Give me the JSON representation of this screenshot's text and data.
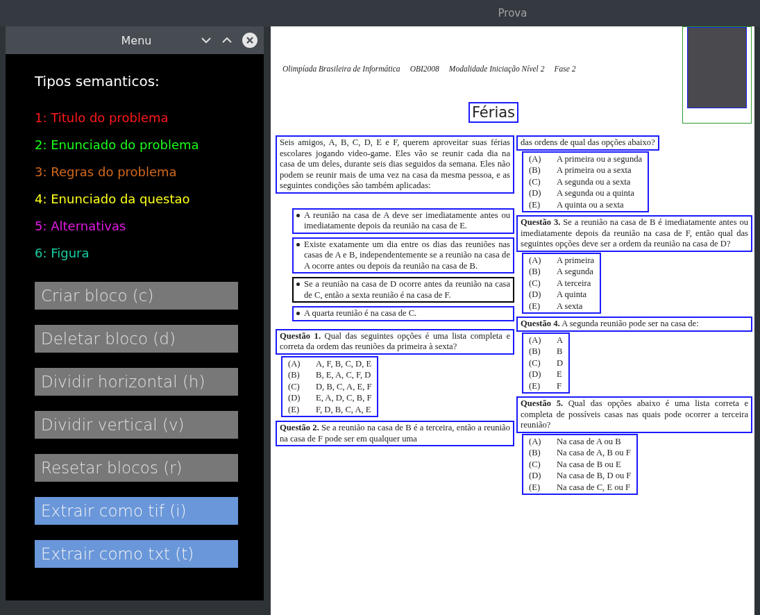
{
  "window": {
    "title": "Prova"
  },
  "menu": {
    "title": "Menu",
    "heading": "Tipos semanticos:",
    "legend": [
      {
        "text": "1: Titulo do problema",
        "color": "#ff1a1a"
      },
      {
        "text": "2: Enunciado do problema",
        "color": "#1aff1a"
      },
      {
        "text": "3: Regras do problema",
        "color": "#d2691e"
      },
      {
        "text": "4: Enunciado da questao",
        "color": "#ffff1a"
      },
      {
        "text": "5: Alternativas",
        "color": "#e01ae0"
      },
      {
        "text": "6: Figura",
        "color": "#1acca0"
      }
    ],
    "buttons": [
      {
        "label": "Criar bloco (c)",
        "color": "#787878"
      },
      {
        "label": "Deletar bloco (d)",
        "color": "#787878"
      },
      {
        "label": "Dividir horizontal (h)",
        "color": "#787878"
      },
      {
        "label": "Dividir vertical (v)",
        "color": "#787878"
      },
      {
        "label": "Resetar blocos (r)",
        "color": "#787878"
      },
      {
        "label": "Extrair como tif (i)",
        "color": "#6a97da"
      },
      {
        "label": "Extrair como txt (t)",
        "color": "#6a97da"
      }
    ]
  },
  "document": {
    "header": [
      "Olimpíada Brasileira de Informática",
      "OBI2008",
      "Modalidade Iniciação Nível 2",
      "Fase 2"
    ],
    "title": {
      "text": "Férias",
      "color": "#1a1aff"
    },
    "left_column": [
      {
        "kind": "paragraph",
        "color": "#1a1aff",
        "text": "Seis amigos, A, B, C, D, E e F, querem aproveitar suas férias escolares jogando video-game. Eles vão se reunir cada dia na casa de um deles, durante seis dias seguidos da semana. Eles não podem se reunir mais de uma vez na casa da mesma pessoa, e as seguintes condições são também aplicadas:"
      },
      {
        "kind": "bullet",
        "color": "#1a1aff",
        "text": "A reunião na casa de A deve ser imediatamente antes ou imediatamente depois da reunião na casa de E."
      },
      {
        "kind": "bullet",
        "color": "#1a1aff",
        "text": "Existe exatamente um dia entre os dias das reuniões nas casas de A e B, independentemente se a reunião na casa de A ocorre antes ou depois da reunião na casa de B."
      },
      {
        "kind": "bullet",
        "color": "#000000",
        "text": "Se a reunião na casa de D ocorre antes da reunião na casa de C, então a sexta reunião é na casa de F."
      },
      {
        "kind": "bullet",
        "color": "#1a1aff",
        "text": "A quarta reunião é na casa de C."
      },
      {
        "kind": "question",
        "color": "#1a1aff",
        "text": "**Questão 1.** Qual das seguintes opções é uma lista completa e correta da ordem das reuniões da primeira à sexta?"
      },
      {
        "kind": "options",
        "color": "#1a1aff",
        "options": [
          {
            "label": "(A)",
            "text": "A, F, B, C, D, E"
          },
          {
            "label": "(B)",
            "text": "B, E, A, C, F, D"
          },
          {
            "label": "(C)",
            "text": "D, B, C, A, E, F"
          },
          {
            "label": "(D)",
            "text": "E, A, D, C, B, F"
          },
          {
            "label": "(E)",
            "text": "F, D, B, C, A, E"
          }
        ]
      },
      {
        "kind": "question",
        "color": "#1a1aff",
        "text": "**Questão 2.** Se a reunião na casa de B é a terceira, então a reunião na casa de F pode ser em qualquer uma"
      }
    ],
    "right_column": [
      {
        "kind": "question",
        "color": "#1a1aff",
        "text": "das ordens de qual das opções abaixo?"
      },
      {
        "kind": "options",
        "color": "#1a1aff",
        "options": [
          {
            "label": "(A)",
            "text": "A primeira ou a segunda"
          },
          {
            "label": "(B)",
            "text": "A primeira ou a sexta"
          },
          {
            "label": "(C)",
            "text": "A segunda ou a sexta"
          },
          {
            "label": "(D)",
            "text": "A segunda ou a quinta"
          },
          {
            "label": "(E)",
            "text": "A quinta ou a sexta"
          }
        ]
      },
      {
        "kind": "question",
        "color": "#1a1aff",
        "text": "**Questão 3.** Se a reunião na casa de B é imediatamente antes ou imediatamente depois da reunião na casa de F, então qual das seguintes opções deve ser a ordem da reunião na casa de D?"
      },
      {
        "kind": "options",
        "color": "#1a1aff",
        "options": [
          {
            "label": "(A)",
            "text": "A primeira"
          },
          {
            "label": "(B)",
            "text": "A segunda"
          },
          {
            "label": "(C)",
            "text": "A terceira"
          },
          {
            "label": "(D)",
            "text": "A quinta"
          },
          {
            "label": "(E)",
            "text": "A sexta"
          }
        ]
      },
      {
        "kind": "question",
        "color": "#1a1aff",
        "text": "**Questão 4.** A segunda reunião pode ser na casa de:"
      },
      {
        "kind": "options",
        "color": "#1a1aff",
        "options": [
          {
            "label": "(A)",
            "text": "A"
          },
          {
            "label": "(B)",
            "text": "B"
          },
          {
            "label": "(C)",
            "text": "D"
          },
          {
            "label": "(D)",
            "text": "E"
          },
          {
            "label": "(E)",
            "text": "F"
          }
        ]
      },
      {
        "kind": "question",
        "color": "#1a1aff",
        "text": "**Questão 5.** Qual das opções abaixo é uma lista correta e completa de possíveis casas nas quais pode ocorrer a terceira reunião?"
      },
      {
        "kind": "options",
        "color": "#1a1aff",
        "options": [
          {
            "label": "(A)",
            "text": "Na casa de A ou B"
          },
          {
            "label": "(B)",
            "text": "Na casa de A, B ou F"
          },
          {
            "label": "(C)",
            "text": "Na casa de B ou E"
          },
          {
            "label": "(D)",
            "text": "Na casa de B, D ou F"
          },
          {
            "label": "(E)",
            "text": "Na casa de C, E ou F"
          }
        ]
      }
    ]
  }
}
